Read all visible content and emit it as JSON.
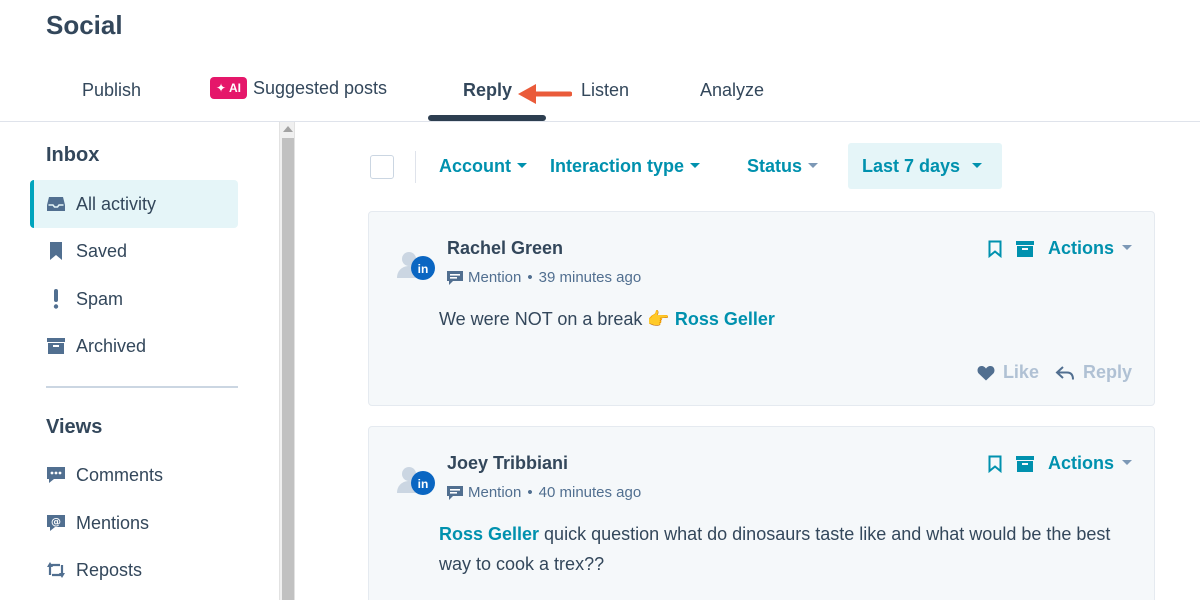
{
  "header": {
    "title": "Social"
  },
  "tabs": [
    {
      "label": "Publish"
    },
    {
      "label": "Suggested posts",
      "badge": "AI"
    },
    {
      "label": "Reply",
      "active": true
    },
    {
      "label": "Listen"
    },
    {
      "label": "Analyze"
    }
  ],
  "sidebar": {
    "inbox_title": "Inbox",
    "inbox_items": [
      {
        "label": "All activity",
        "icon": "inbox-icon",
        "active": true
      },
      {
        "label": "Saved",
        "icon": "bookmark-icon"
      },
      {
        "label": "Spam",
        "icon": "exclamation-icon"
      },
      {
        "label": "Archived",
        "icon": "archive-icon"
      }
    ],
    "views_title": "Views",
    "views_items": [
      {
        "label": "Comments",
        "icon": "comment-icon"
      },
      {
        "label": "Mentions",
        "icon": "mention-icon"
      },
      {
        "label": "Reposts",
        "icon": "repost-icon"
      }
    ]
  },
  "filters": {
    "account": "Account",
    "interaction_type": "Interaction type",
    "status": "Status",
    "date_range": "Last 7 days"
  },
  "posts": [
    {
      "author": "Rachel Green",
      "network": "linkedin",
      "type": "Mention",
      "time": "39 minutes ago",
      "text_before": "We were NOT on a break 👉 ",
      "mention": "Ross Geller",
      "text_after": "",
      "actions_label": "Actions",
      "like_label": "Like",
      "reply_label": "Reply"
    },
    {
      "author": "Joey Tribbiani",
      "network": "linkedin",
      "type": "Mention",
      "time": "40 minutes ago",
      "text_before": "",
      "mention": "Ross Geller",
      "text_after": " quick question what do dinosaurs taste like and what would be the best way to cook a trex??",
      "actions_label": "Actions",
      "like_label": "Like",
      "reply_label": "Reply"
    }
  ],
  "colors": {
    "accent": "#0091ae",
    "active_bg": "#e5f5f8",
    "ai_badge": "#e5176a",
    "arrow": "#ea5b3a",
    "linkedin": "#0a66c2"
  }
}
